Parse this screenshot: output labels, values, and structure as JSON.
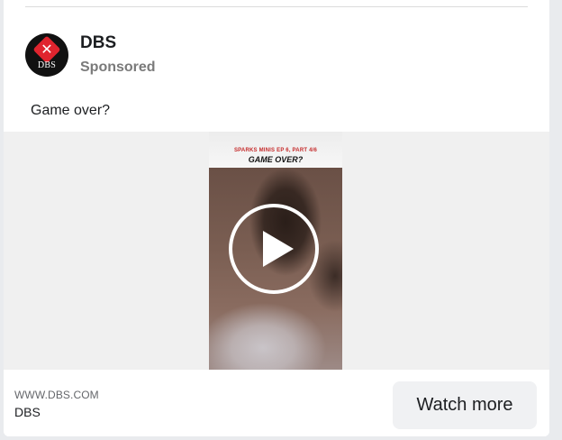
{
  "ad": {
    "page_name": "DBS",
    "sponsored_label": "Sponsored",
    "logo_text": "DBS",
    "caption": "Game over?",
    "video": {
      "banner_subtitle": "SPARKS MINIS EP 6, PART 4/6",
      "banner_title": "GAME OVER?",
      "play_icon": "play-icon"
    },
    "footer": {
      "domain": "WWW.DBS.COM",
      "name": "DBS",
      "cta_label": "Watch more"
    }
  },
  "colors": {
    "brand_red": "#e0242e",
    "text_primary": "#1c1e21",
    "text_secondary": "#7a7a7a",
    "cta_bg": "#f0f1f3"
  }
}
